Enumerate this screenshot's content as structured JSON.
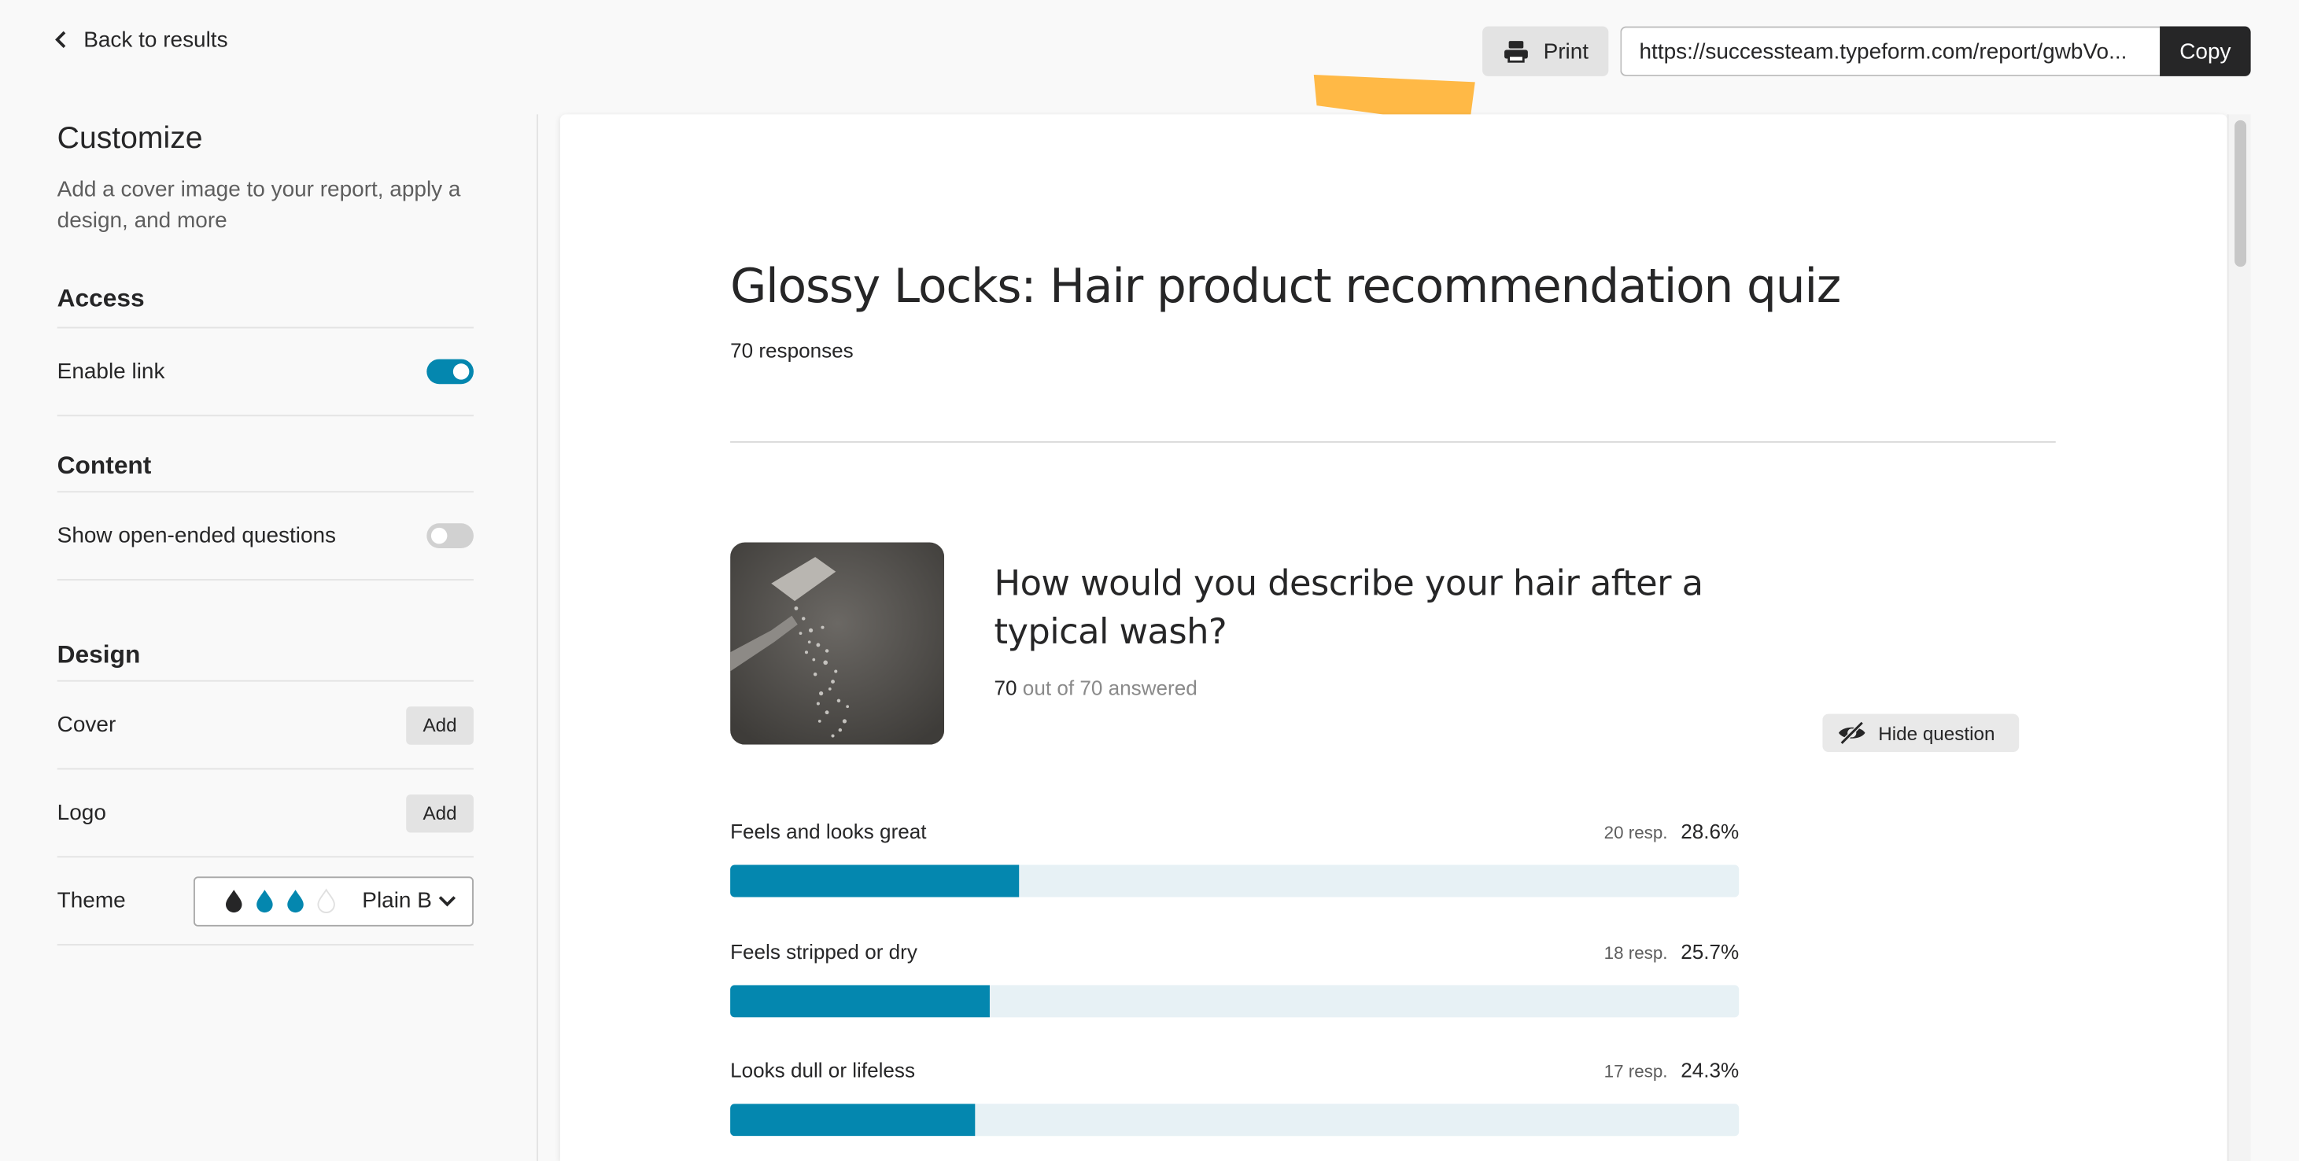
{
  "topbar": {
    "back_label": "Back to results",
    "print_label": "Print",
    "share_url": "https://successteam.typeform.com/report/gwbVo...",
    "copy_label": "Copy"
  },
  "sidebar": {
    "title": "Customize",
    "description": "Add a cover image to your report, apply a design, and more",
    "access": {
      "heading": "Access",
      "enable_link_label": "Enable link",
      "enable_link_on": true
    },
    "content": {
      "heading": "Content",
      "open_ended_label": "Show open-ended questions",
      "open_ended_on": false
    },
    "design": {
      "heading": "Design",
      "cover_label": "Cover",
      "cover_button": "Add",
      "logo_label": "Logo",
      "logo_button": "Add",
      "theme_label": "Theme",
      "theme_value": "Plain B",
      "theme_drops": [
        "#262627",
        "#0487af",
        "#0487af",
        "#ffffff"
      ]
    }
  },
  "report": {
    "title": "Glossy Locks: Hair product recommendation quiz",
    "responses": "70 responses",
    "question": {
      "title": "How would you describe your hair after a typical wash?",
      "answered_count": "70",
      "answered_suffix": "out of 70 answered",
      "hide_label": "Hide question",
      "answers": [
        {
          "label": "Feels and looks great",
          "resp": "20 resp.",
          "pct": "28.6%",
          "fraction": 0.286
        },
        {
          "label": "Feels stripped or dry",
          "resp": "18 resp.",
          "pct": "25.7%",
          "fraction": 0.257
        },
        {
          "label": "Looks dull or lifeless",
          "resp": "17 resp.",
          "pct": "24.3%",
          "fraction": 0.243
        }
      ]
    }
  },
  "colors": {
    "accent": "#0487af",
    "bar_track": "#e7f1f5",
    "annotation_arrow": "#ffb946"
  }
}
